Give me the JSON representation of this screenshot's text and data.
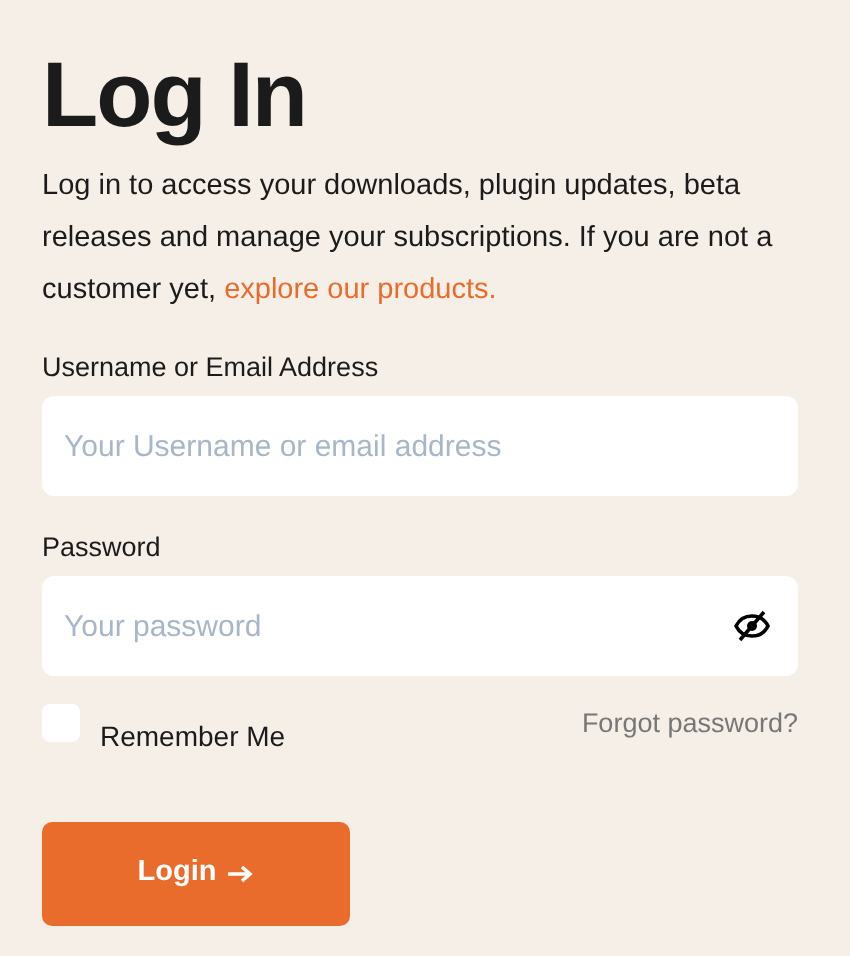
{
  "title": "Log In",
  "intro": {
    "text": "Log in to access your downloads, plugin updates, beta releases and manage your subscriptions. If you are not a customer yet, ",
    "link": "explore our products."
  },
  "fields": [
    {
      "label": "Username or Email Address",
      "placeholder": "Your Username or email address",
      "kind": "text"
    },
    {
      "label": "Password",
      "placeholder": "Your password",
      "kind": "password"
    }
  ],
  "remember": {
    "label": "Remember Me",
    "checked": false
  },
  "forgot": "Forgot password?",
  "submit": "Login"
}
